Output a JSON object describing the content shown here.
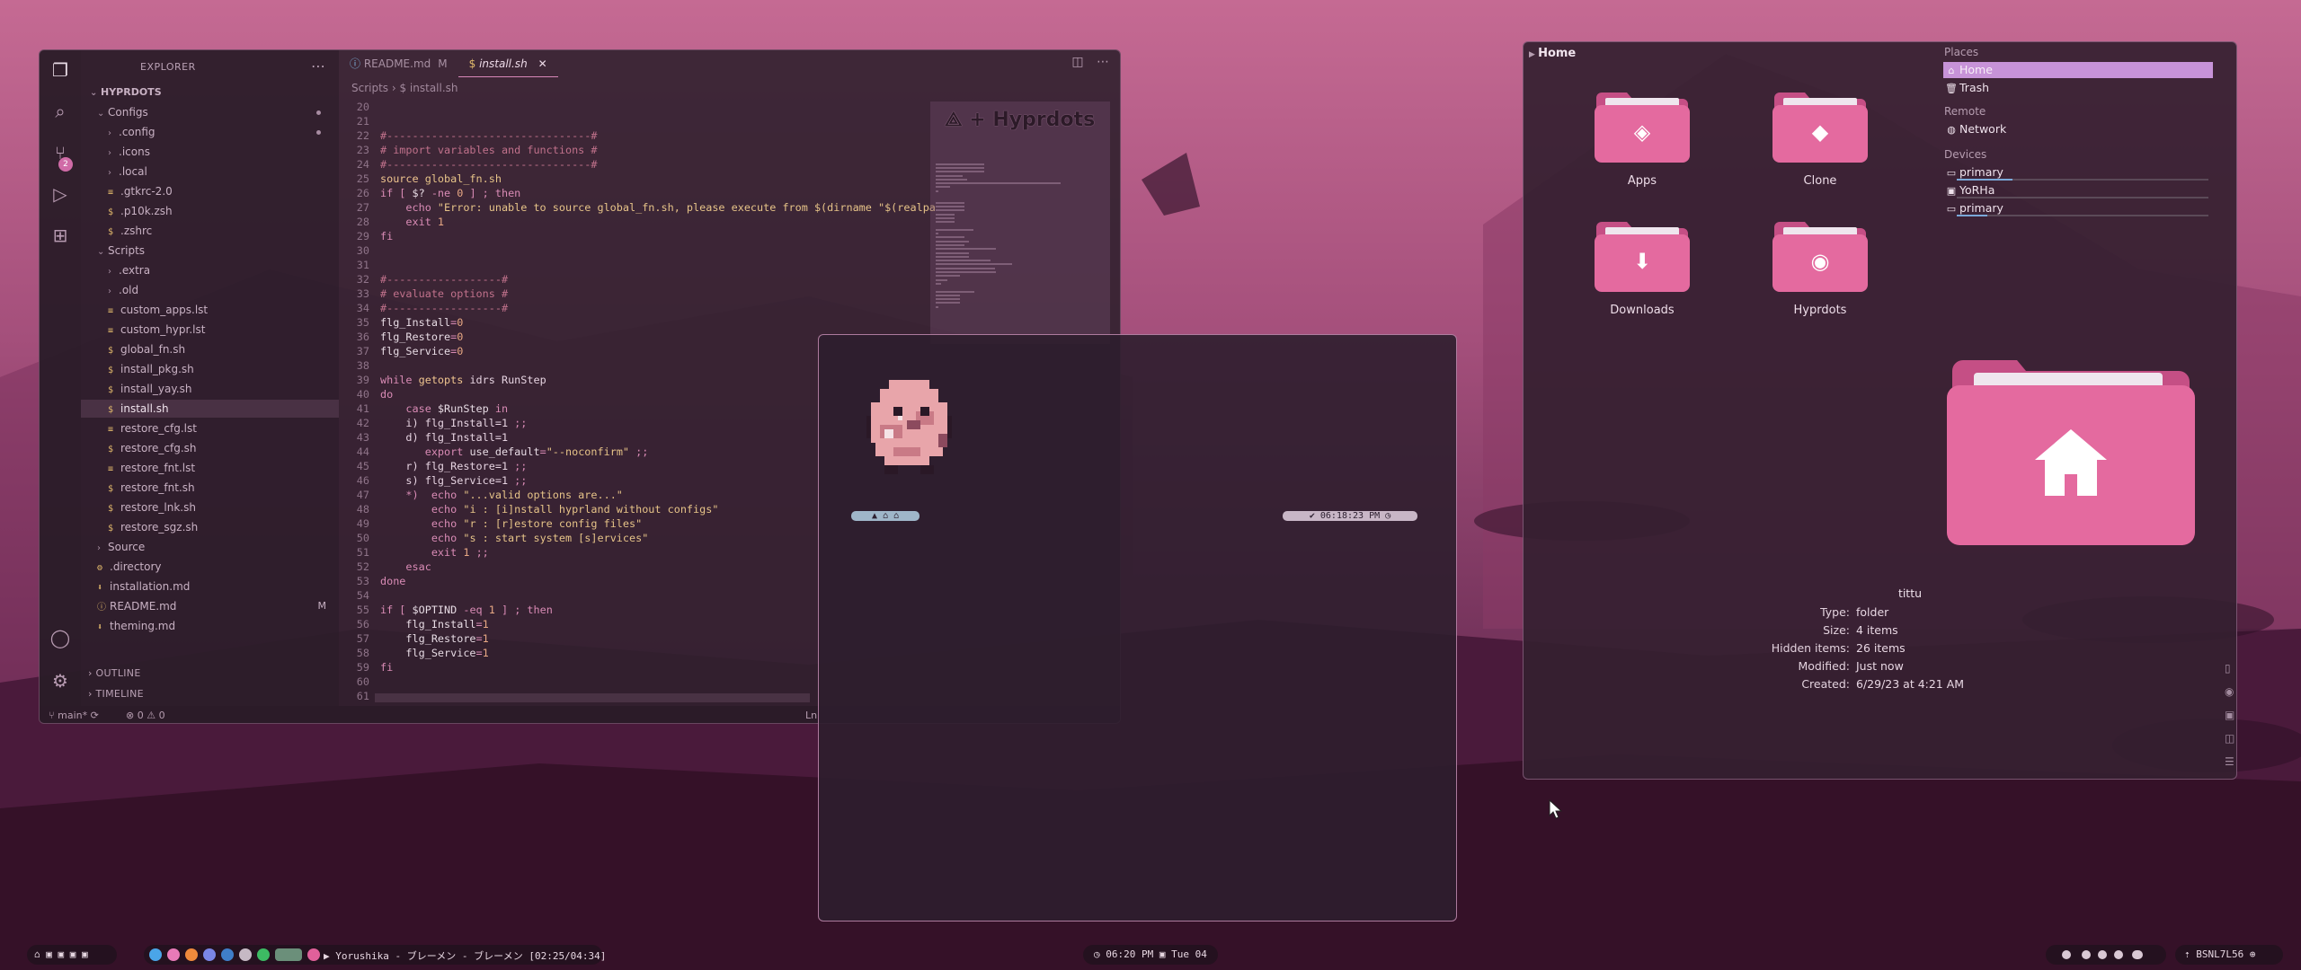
{
  "vscode": {
    "explorer_title": "EXPLORER",
    "badge": "2",
    "tabs": [
      {
        "label": "README.md",
        "mod": "M"
      },
      {
        "label": "install.sh",
        "close": "✕"
      }
    ],
    "breadcrumb": "Scripts  ›  $  install.sh",
    "root": "HYPRDOTS",
    "tree": [
      {
        "label": "Configs",
        "chev": "⌄",
        "indent": 1,
        "dot": true
      },
      {
        "label": ".config",
        "chev": "›",
        "indent": 2,
        "dot": true
      },
      {
        "label": ".icons",
        "chev": "›",
        "indent": 2
      },
      {
        "label": ".local",
        "chev": "›",
        "indent": 2
      },
      {
        "label": ".gtkrc-2.0",
        "glyph": "≡",
        "indent": 2
      },
      {
        "label": ".p10k.zsh",
        "glyph": "$",
        "indent": 2
      },
      {
        "label": ".zshrc",
        "glyph": "$",
        "indent": 2
      },
      {
        "label": "Scripts",
        "chev": "⌄",
        "indent": 1
      },
      {
        "label": ".extra",
        "chev": "›",
        "indent": 2
      },
      {
        "label": ".old",
        "chev": "›",
        "indent": 2
      },
      {
        "label": "custom_apps.lst",
        "glyph": "≡",
        "indent": 2
      },
      {
        "label": "custom_hypr.lst",
        "glyph": "≡",
        "indent": 2
      },
      {
        "label": "global_fn.sh",
        "glyph": "$",
        "indent": 2
      },
      {
        "label": "install_pkg.sh",
        "glyph": "$",
        "indent": 2
      },
      {
        "label": "install_yay.sh",
        "glyph": "$",
        "indent": 2
      },
      {
        "label": "install.sh",
        "glyph": "$",
        "indent": 2,
        "selected": true
      },
      {
        "label": "restore_cfg.lst",
        "glyph": "≡",
        "indent": 2
      },
      {
        "label": "restore_cfg.sh",
        "glyph": "$",
        "indent": 2
      },
      {
        "label": "restore_fnt.lst",
        "glyph": "≡",
        "indent": 2
      },
      {
        "label": "restore_fnt.sh",
        "glyph": "$",
        "indent": 2
      },
      {
        "label": "restore_lnk.sh",
        "glyph": "$",
        "indent": 2
      },
      {
        "label": "restore_sgz.sh",
        "glyph": "$",
        "indent": 2
      },
      {
        "label": "Source",
        "chev": "›",
        "indent": 1
      },
      {
        "label": ".directory",
        "glyph": "⚙",
        "indent": 1
      },
      {
        "label": "installation.md",
        "glyph": "⬇",
        "indent": 1
      },
      {
        "label": "README.md",
        "glyph": "ⓘ",
        "indent": 1,
        "mark": "M"
      },
      {
        "label": "theming.md",
        "glyph": "⬇",
        "indent": 1
      }
    ],
    "outline": "OUTLINE",
    "timeline": "TIMELINE",
    "status_branch": "main*",
    "status_problems": "⊗ 0 ⚠ 0",
    "status_right": "Ln",
    "minimap_logo": "⟁ + Hyprdots",
    "code": [
      {
        "n": "20",
        "t": [
          [
            "",
            "plain"
          ]
        ]
      },
      {
        "n": "21",
        "t": [
          [
            "",
            "plain"
          ]
        ]
      },
      {
        "n": "22",
        "t": [
          [
            "#--------------------------------#",
            "com"
          ]
        ]
      },
      {
        "n": "23",
        "t": [
          [
            "# import variables and functions #",
            "com"
          ]
        ]
      },
      {
        "n": "24",
        "t": [
          [
            "#--------------------------------#",
            "com"
          ]
        ]
      },
      {
        "n": "25",
        "t": [
          [
            "source ",
            "fn"
          ],
          [
            "global_fn.sh",
            "str"
          ]
        ]
      },
      {
        "n": "26",
        "t": [
          [
            "if [ ",
            "kw"
          ],
          [
            "$? ",
            "var"
          ],
          [
            "-ne ",
            "kw"
          ],
          [
            "0 ",
            "num"
          ],
          [
            "] ; then",
            "kw"
          ]
        ]
      },
      {
        "n": "27",
        "t": [
          [
            "    echo ",
            "kw"
          ],
          [
            "\"Error: unable to source global_fn.sh, please execute from $(dirname \"$(realpa",
            "str"
          ]
        ]
      },
      {
        "n": "28",
        "t": [
          [
            "    exit ",
            "kw"
          ],
          [
            "1",
            "num"
          ]
        ]
      },
      {
        "n": "29",
        "t": [
          [
            "fi",
            "kw"
          ]
        ]
      },
      {
        "n": "30",
        "t": [
          [
            "",
            "plain"
          ]
        ]
      },
      {
        "n": "31",
        "t": [
          [
            "",
            "plain"
          ]
        ]
      },
      {
        "n": "32",
        "t": [
          [
            "#------------------#",
            "com"
          ]
        ]
      },
      {
        "n": "33",
        "t": [
          [
            "# evaluate options #",
            "com"
          ]
        ]
      },
      {
        "n": "34",
        "t": [
          [
            "#------------------#",
            "com"
          ]
        ]
      },
      {
        "n": "35",
        "t": [
          [
            "flg_Install",
            "var"
          ],
          [
            "=",
            "kw"
          ],
          [
            "0",
            "num"
          ]
        ]
      },
      {
        "n": "36",
        "t": [
          [
            "flg_Restore",
            "var"
          ],
          [
            "=",
            "kw"
          ],
          [
            "0",
            "num"
          ]
        ]
      },
      {
        "n": "37",
        "t": [
          [
            "flg_Service",
            "var"
          ],
          [
            "=",
            "kw"
          ],
          [
            "0",
            "num"
          ]
        ]
      },
      {
        "n": "38",
        "t": [
          [
            "",
            "plain"
          ]
        ]
      },
      {
        "n": "39",
        "t": [
          [
            "while ",
            "kw"
          ],
          [
            "getopts ",
            "fn"
          ],
          [
            "idrs RunStep",
            "plain"
          ]
        ]
      },
      {
        "n": "40",
        "t": [
          [
            "do",
            "kw"
          ]
        ]
      },
      {
        "n": "41",
        "t": [
          [
            "    case ",
            "kw"
          ],
          [
            "$RunStep ",
            "var"
          ],
          [
            "in",
            "kw"
          ]
        ]
      },
      {
        "n": "42",
        "t": [
          [
            "    i) flg_Install=1 ",
            "plain"
          ],
          [
            ";;",
            "kw"
          ]
        ]
      },
      {
        "n": "43",
        "t": [
          [
            "    d) flg_Install=1",
            "plain"
          ]
        ]
      },
      {
        "n": "44",
        "t": [
          [
            "       export ",
            "kw"
          ],
          [
            "use_default",
            "var"
          ],
          [
            "=",
            "kw"
          ],
          [
            "\"--noconfirm\" ",
            "str"
          ],
          [
            ";;",
            "kw"
          ]
        ]
      },
      {
        "n": "45",
        "t": [
          [
            "    r) flg_Restore=1 ",
            "plain"
          ],
          [
            ";;",
            "kw"
          ]
        ]
      },
      {
        "n": "46",
        "t": [
          [
            "    s) flg_Service=1 ",
            "plain"
          ],
          [
            ";;",
            "kw"
          ]
        ]
      },
      {
        "n": "47",
        "t": [
          [
            "    *)  echo ",
            "kw"
          ],
          [
            "\"...valid options are...\"",
            "str"
          ]
        ]
      },
      {
        "n": "48",
        "t": [
          [
            "        echo ",
            "kw"
          ],
          [
            "\"i : [i]nstall hyprland without configs\"",
            "str"
          ]
        ]
      },
      {
        "n": "49",
        "t": [
          [
            "        echo ",
            "kw"
          ],
          [
            "\"r : [r]estore config files\"",
            "str"
          ]
        ]
      },
      {
        "n": "50",
        "t": [
          [
            "        echo ",
            "kw"
          ],
          [
            "\"s : start system [s]ervices\"",
            "str"
          ]
        ]
      },
      {
        "n": "51",
        "t": [
          [
            "        exit ",
            "kw"
          ],
          [
            "1 ",
            "num"
          ],
          [
            ";;",
            "kw"
          ]
        ]
      },
      {
        "n": "52",
        "t": [
          [
            "    esac",
            "kw"
          ]
        ]
      },
      {
        "n": "53",
        "t": [
          [
            "done",
            "kw"
          ]
        ]
      },
      {
        "n": "54",
        "t": [
          [
            "",
            "plain"
          ]
        ]
      },
      {
        "n": "55",
        "t": [
          [
            "if [ ",
            "kw"
          ],
          [
            "$OPTIND ",
            "var"
          ],
          [
            "-eq ",
            "kw"
          ],
          [
            "1 ",
            "num"
          ],
          [
            "] ; then",
            "kw"
          ]
        ]
      },
      {
        "n": "56",
        "t": [
          [
            "    flg_Install",
            "var"
          ],
          [
            "=",
            "kw"
          ],
          [
            "1",
            "num"
          ]
        ]
      },
      {
        "n": "57",
        "t": [
          [
            "    flg_Restore",
            "var"
          ],
          [
            "=",
            "kw"
          ],
          [
            "1",
            "num"
          ]
        ]
      },
      {
        "n": "58",
        "t": [
          [
            "    flg_Service",
            "var"
          ],
          [
            "=",
            "kw"
          ],
          [
            "1",
            "num"
          ]
        ]
      },
      {
        "n": "59",
        "t": [
          [
            "fi",
            "kw"
          ]
        ]
      },
      {
        "n": "60",
        "t": [
          [
            "",
            "plain"
          ]
        ]
      },
      {
        "n": "61",
        "t": [
          [
            "",
            "plain"
          ]
        ]
      }
    ]
  },
  "terminal": {
    "prompt_left": "▲  ⌂  ⌂",
    "prompt_right": "✔  06:18:23 PM ◷"
  },
  "dolphin": {
    "breadcrumb": "Home",
    "folders": [
      {
        "label": "Apps",
        "icon": "◈"
      },
      {
        "label": "Clone",
        "icon": "◆"
      },
      {
        "label": "Downloads",
        "icon": "⬇"
      },
      {
        "label": "Hyprdots",
        "icon": "◉"
      }
    ],
    "places_title": "Places",
    "places": [
      {
        "label": "Home",
        "icon": "⌂",
        "selected": true
      },
      {
        "label": "Trash",
        "icon": "🗑"
      }
    ],
    "remote_title": "Remote",
    "remote": [
      {
        "label": "Network",
        "icon": "◍"
      }
    ],
    "devices_title": "Devices",
    "devices": [
      {
        "label": "primary",
        "icon": "▭",
        "usage": 0.22
      },
      {
        "label": "YoRHa",
        "icon": "▣",
        "usage": 0
      },
      {
        "label": "primary",
        "icon": "▭",
        "usage": 0.12
      }
    ],
    "selected_name": "tittu",
    "info": [
      {
        "label": "Type:",
        "value": "folder"
      },
      {
        "label": "Size:",
        "value": "4 items"
      },
      {
        "label": "Hidden items:",
        "value": "26 items"
      },
      {
        "label": "Modified:",
        "value": "Just now"
      },
      {
        "label": "Created:",
        "value": "6/29/23 at 4:21 AM"
      }
    ]
  },
  "taskbar": {
    "workspaces": "⌂ ▣ ▣ ▣ ▣",
    "media": "▶ Yorushika - ブレーメン - ブレーメン [02:25/04:34]",
    "clock": "◷ 06:20 PM  ▣ Tue 04",
    "network": "⇡ BSNL7L56 ⊕",
    "colors": {
      "accent": "#e0609a",
      "bg": "#2a1a2a"
    }
  }
}
